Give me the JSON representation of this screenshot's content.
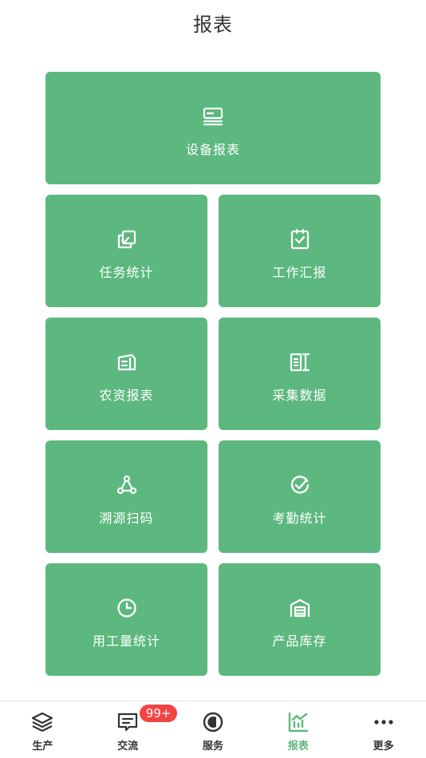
{
  "header": {
    "title": "报表"
  },
  "tiles": [
    {
      "label": "设备报表",
      "icon": "device-icon"
    },
    {
      "label": "任务统计",
      "icon": "task-copy-icon"
    },
    {
      "label": "工作汇报",
      "icon": "clipboard-check-icon"
    },
    {
      "label": "农资报表",
      "icon": "document-stack-icon"
    },
    {
      "label": "采集数据",
      "icon": "data-collect-icon"
    },
    {
      "label": "溯源扫码",
      "icon": "trace-nodes-icon"
    },
    {
      "label": "考勤统计",
      "icon": "check-circle-icon"
    },
    {
      "label": "用工量统计",
      "icon": "clock-icon"
    },
    {
      "label": "产品库存",
      "icon": "warehouse-icon"
    }
  ],
  "tabbar": {
    "items": [
      {
        "label": "生产",
        "icon": "layers-icon"
      },
      {
        "label": "交流",
        "icon": "message-icon",
        "badge": "99+"
      },
      {
        "label": "服务",
        "icon": "service-icon"
      },
      {
        "label": "报表",
        "icon": "chart-icon",
        "active": true
      },
      {
        "label": "更多",
        "icon": "more-dots-icon"
      }
    ]
  },
  "colors": {
    "tile": "#5cb87e",
    "accent": "#5cb87e",
    "badge": "#f24444"
  }
}
